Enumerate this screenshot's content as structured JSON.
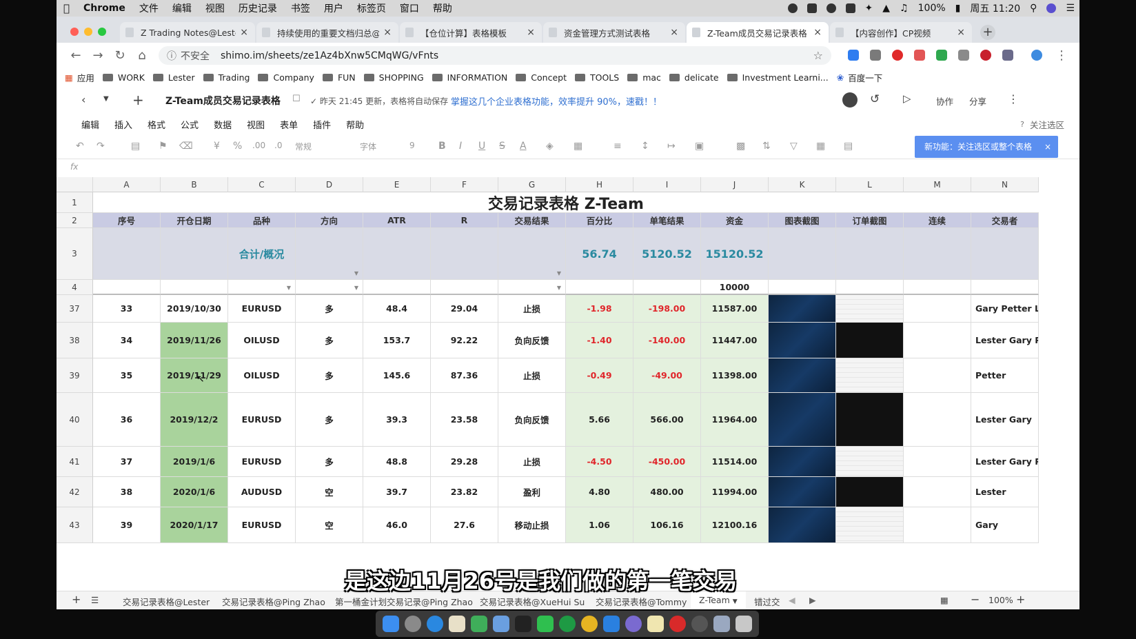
{
  "mac_menu": {
    "apple_icon": "apple-icon",
    "app": "Chrome",
    "items": [
      "文件",
      "编辑",
      "视图",
      "历史记录",
      "书签",
      "用户",
      "标签页",
      "窗口",
      "帮助"
    ],
    "status_right": {
      "battery": "100%",
      "clock": "周五 11:20"
    }
  },
  "browser": {
    "tabs": [
      {
        "title": "Z Trading Notes@Lester",
        "active": false
      },
      {
        "title": "持续使用的重要文档归总@L",
        "active": false
      },
      {
        "title": "【仓位计算】表格模板",
        "active": false
      },
      {
        "title": "资金管理方式测试表格",
        "active": false
      },
      {
        "title": "Z-Team成员交易记录表格",
        "active": true
      },
      {
        "title": "【内容创作】CP视频",
        "active": false
      }
    ],
    "close_glyph": "×",
    "new_tab_glyph": "+",
    "address": {
      "security": "不安全",
      "url": "shimo.im/sheets/ze1Az4bXnw5CMqWG/vFnts"
    },
    "bookmarks": [
      "应用",
      "WORK",
      "Lester",
      "Trading",
      "Company",
      "FUN",
      "SHOPPING",
      "INFORMATION",
      "Concept",
      "TOOLS",
      "mac",
      "delicate",
      "Investment Learni...",
      "百度一下"
    ]
  },
  "doc": {
    "title": "Z-Team成员交易记录表格",
    "save_status": "昨天 21:45 更新，表格将自动保存",
    "promo": "掌握这几个企业表格功能，效率提升 90%，速戳！！",
    "actions": {
      "collab": "协作",
      "share": "分享"
    },
    "menu": [
      "编辑",
      "插入",
      "格式",
      "公式",
      "数据",
      "视图",
      "表单",
      "插件",
      "帮助"
    ],
    "focus_area": "关注选区",
    "toolbar": {
      "currency": "¥",
      "percent": "%",
      "dec_more": ".00",
      "dec_less": ".0",
      "format": "常规",
      "font": "字体",
      "font_size": "9",
      "bold": "B",
      "italic": "I",
      "underline": "U",
      "strike": "S",
      "color": "A"
    },
    "banner": "新功能：关注选区或整个表格",
    "fx": "fx"
  },
  "sheet": {
    "columns": [
      "A",
      "B",
      "C",
      "D",
      "E",
      "F",
      "G",
      "H",
      "I",
      "J",
      "K",
      "L",
      "M",
      "N"
    ],
    "title_row": {
      "row": "1",
      "text": "交易记录表格 Z-Team"
    },
    "header_row": {
      "row": "2",
      "cells": [
        "序号",
        "开仓日期",
        "品种",
        "方向",
        "ATR",
        "R",
        "交易结果",
        "百分比",
        "单笔结果",
        "资金",
        "图表截图",
        "订单截图",
        "连续",
        "交易者"
      ]
    },
    "summary_row": {
      "row": "3",
      "label": "合计/概况",
      "percent": "56.74",
      "result": "5120.52",
      "capital": "15120.52"
    },
    "init_row": {
      "row": "4",
      "capital": "10000"
    },
    "rows": [
      {
        "row": "37",
        "no": "33",
        "date": "2019/10/30",
        "symbol": "EURUSD",
        "dir": "多",
        "atr": "48.4",
        "r": "29.04",
        "outcome": "止损",
        "pct": "-1.98",
        "pnl": "-198.00",
        "capital": "11587.00",
        "trader": "Gary Petter Le"
      },
      {
        "row": "38",
        "no": "34",
        "date": "2019/11/26",
        "symbol": "OILUSD",
        "dir": "多",
        "atr": "153.7",
        "r": "92.22",
        "outcome": "负向反馈",
        "pct": "-1.40",
        "pnl": "-140.00",
        "capital": "11447.00",
        "trader": "Lester Gary Pe"
      },
      {
        "row": "39",
        "no": "35",
        "date": "2019/11/29",
        "symbol": "OILUSD",
        "dir": "多",
        "atr": "145.6",
        "r": "87.36",
        "outcome": "止损",
        "pct": "-0.49",
        "pnl": "-49.00",
        "capital": "11398.00",
        "trader": "Petter"
      },
      {
        "row": "40",
        "no": "36",
        "date": "2019/12/2",
        "symbol": "EURUSD",
        "dir": "多",
        "atr": "39.3",
        "r": "23.58",
        "outcome": "负向反馈",
        "pct": "5.66",
        "pnl": "566.00",
        "capital": "11964.00",
        "trader": "Lester  Gary"
      },
      {
        "row": "41",
        "no": "37",
        "date": "2019/1/6",
        "symbol": "EURUSD",
        "dir": "多",
        "atr": "48.8",
        "r": "29.28",
        "outcome": "止损",
        "pct": "-4.50",
        "pnl": "-450.00",
        "capital": "11514.00",
        "trader": "Lester Gary Pe"
      },
      {
        "row": "42",
        "no": "38",
        "date": "2020/1/6",
        "symbol": "AUDUSD",
        "dir": "空",
        "atr": "39.7",
        "r": "23.82",
        "outcome": "盈利",
        "pct": "4.80",
        "pnl": "480.00",
        "capital": "11994.00",
        "trader": "Lester"
      },
      {
        "row": "43",
        "no": "39",
        "date": "2020/1/17",
        "symbol": "EURUSD",
        "dir": "空",
        "atr": "46.0",
        "r": "27.6",
        "outcome": "移动止损",
        "pct": "1.06",
        "pnl": "106.16",
        "capital": "12100.16",
        "trader": "Gary"
      }
    ],
    "sheet_tabs": [
      "交易记录表格@Lester",
      "交易记录表格@Ping Zhao",
      "第一桶金计划交易记录@Ping Zhao",
      "交易记录表格@XueHui Su",
      "交易记录表格@Tommy",
      "Z-Team",
      "错过交"
    ],
    "zoom": "100%"
  },
  "subtitle": "是这边11月26号是我们做的第一笔交易",
  "colors": {
    "header_purple": "#c9cbe3",
    "summary_gray": "#d9dbe6",
    "green_fill": "#e4f1de",
    "date_green": "#a9d39c",
    "loss_red": "#e0262b",
    "banner_blue": "#5b8ff0",
    "accent_teal": "#2a8aa0"
  }
}
